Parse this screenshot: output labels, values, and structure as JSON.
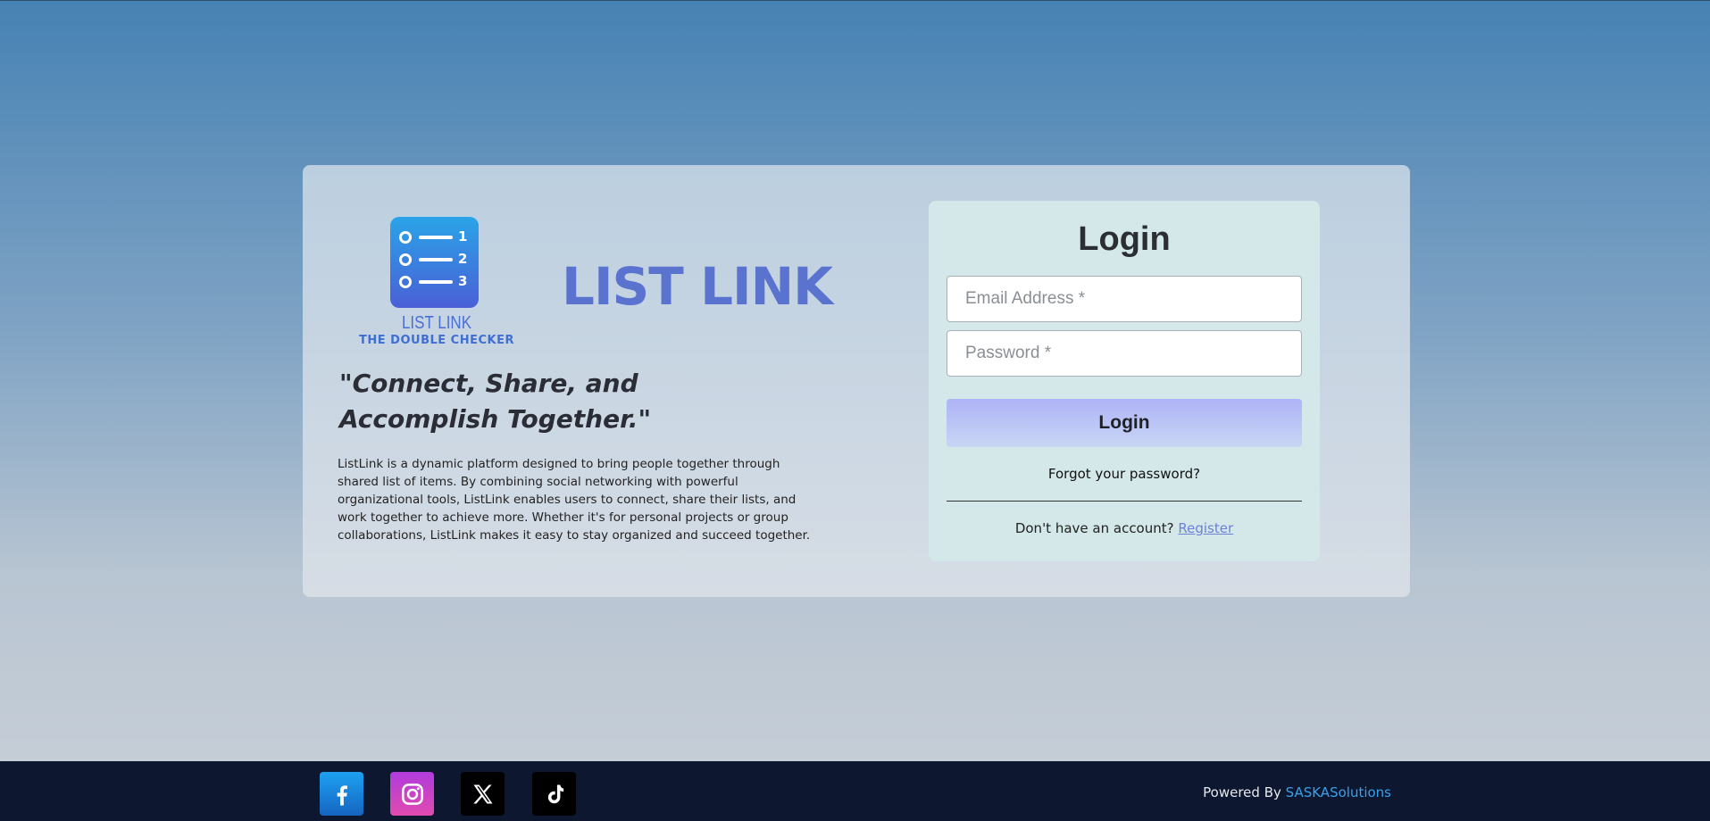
{
  "brand": {
    "logo_title": "LIST LINK",
    "logo_subtitle": "THE DOUBLE CHECKER",
    "logo_numbers": [
      "1",
      "2",
      "3"
    ],
    "name": "LIST LINK",
    "tagline": "\"Connect, Share, and Accomplish Together.\"",
    "description": "ListLink is a dynamic platform designed to bring people together through shared list of items. By combining social networking with powerful organizational tools, ListLink enables users to connect, share their lists, and work together to achieve more. Whether it's for personal projects or group collaborations, ListLink makes it easy to stay organized and succeed together."
  },
  "login": {
    "title": "Login",
    "email_placeholder": "Email Address *",
    "password_placeholder": "Password *",
    "submit_label": "Login",
    "forgot_label": "Forgot your password?",
    "no_account_text": "Don't have an account?",
    "register_label": "Register"
  },
  "footer": {
    "social": [
      "facebook-icon",
      "instagram-icon",
      "x-icon",
      "tiktok-icon"
    ],
    "powered_prefix": "Powered By",
    "powered_company": "SASKASolutions"
  },
  "colors": {
    "accent": "#5a73cf",
    "login_button": "#aeb3f7",
    "footer_bg": "#0d1730",
    "link": "#3aa0e8"
  }
}
